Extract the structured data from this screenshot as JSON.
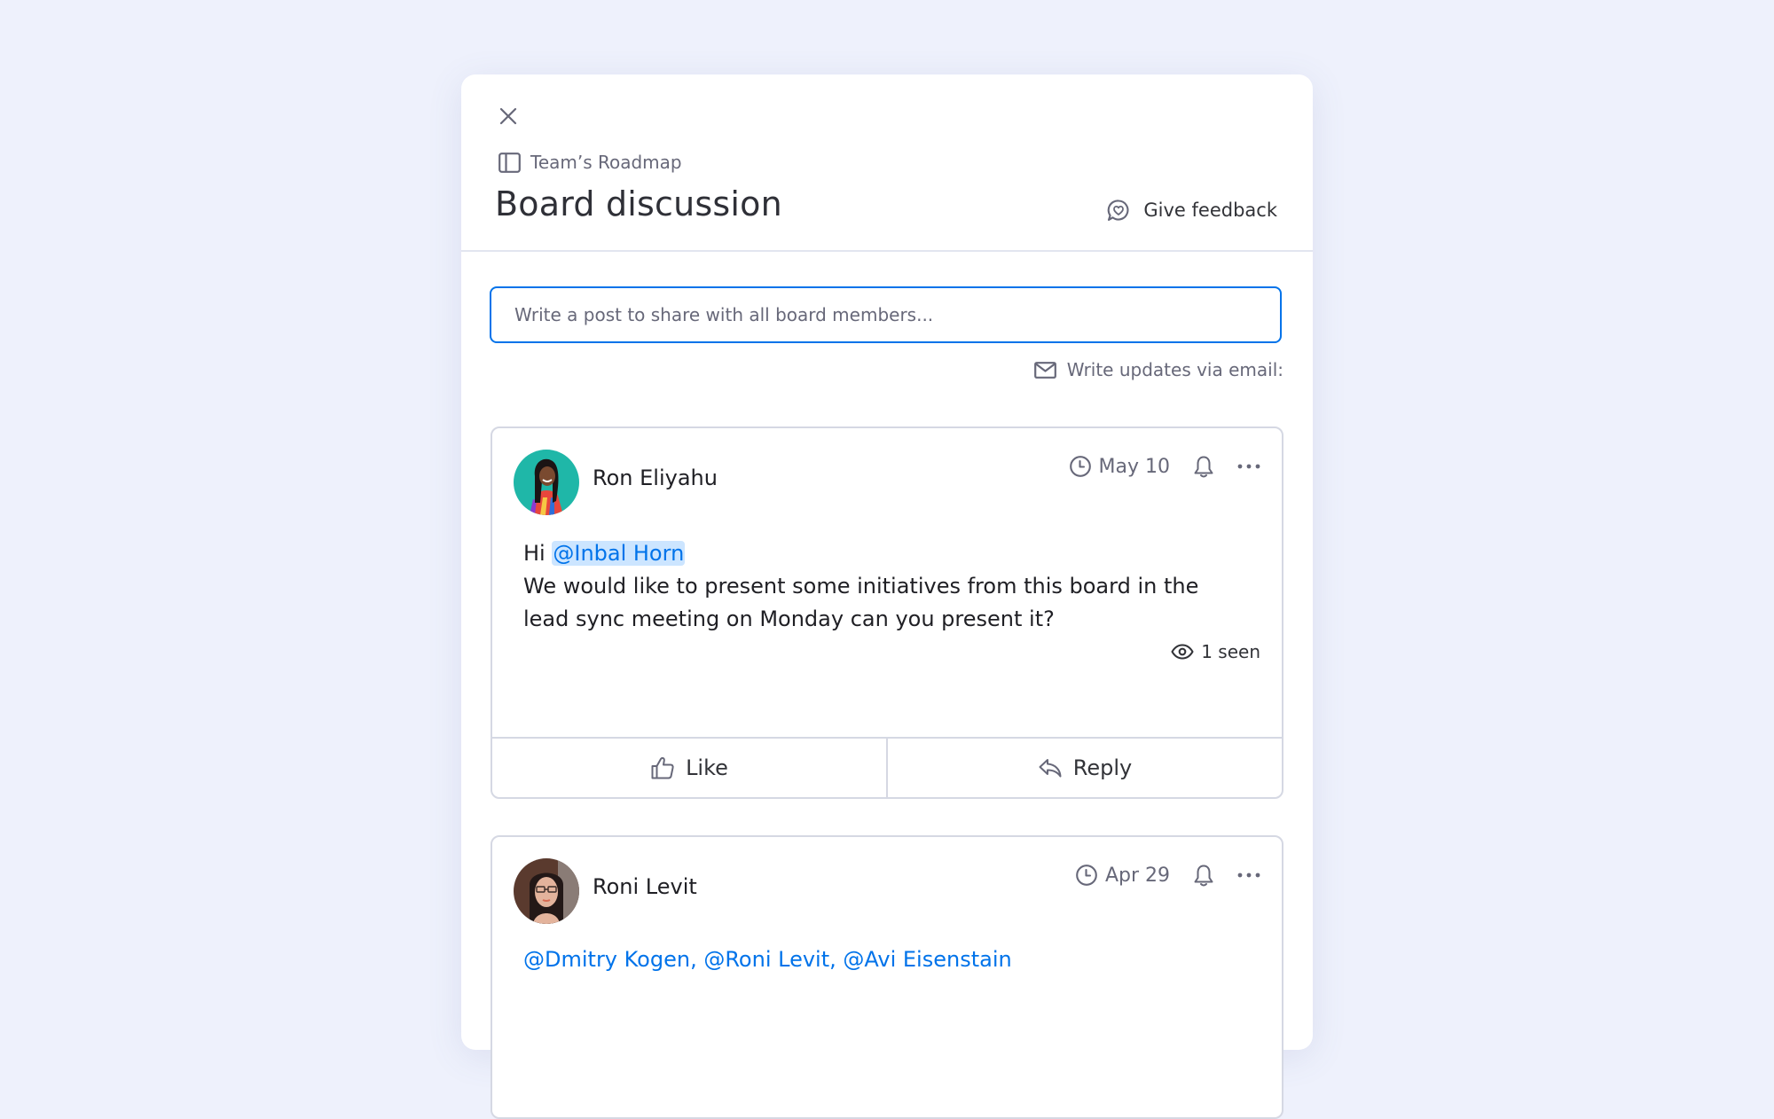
{
  "panel": {
    "close_label": "Close",
    "breadcrumb": {
      "icon": "board-icon",
      "board_name": "Team’s Roadmap"
    },
    "title": "Board discussion",
    "feedback": {
      "icon": "feedback-heart-bubble-icon",
      "label": "Give feedback"
    },
    "composer": {
      "placeholder": "Write a post to share with all board members...",
      "value": ""
    },
    "email_updates": {
      "icon": "envelope-icon",
      "label": "Write updates via email:"
    }
  },
  "posts": [
    {
      "author": "Ron Eliyahu",
      "avatar": "avatar-photo",
      "date": "May 10",
      "greeting": "Hi",
      "mention": "@Inbal Horn",
      "text": "We would like to present some initiatives from this board in the lead sync meeting on Monday can you present it?",
      "seen": "1 seen",
      "actions": {
        "like": "Like",
        "reply": "Reply"
      }
    },
    {
      "author": "Roni Levit",
      "avatar": "avatar-photo",
      "date": "Apr 29",
      "mentions": "@Dmitry Kogen, @Roni Levit, @Avi Eisenstain"
    }
  ],
  "colors": {
    "background": "#eef1fc",
    "accent": "#0073ea",
    "mention_highlight": "#cce5ff",
    "text_primary": "#323338",
    "text_secondary": "#676879",
    "border": "#d5d8e3"
  }
}
